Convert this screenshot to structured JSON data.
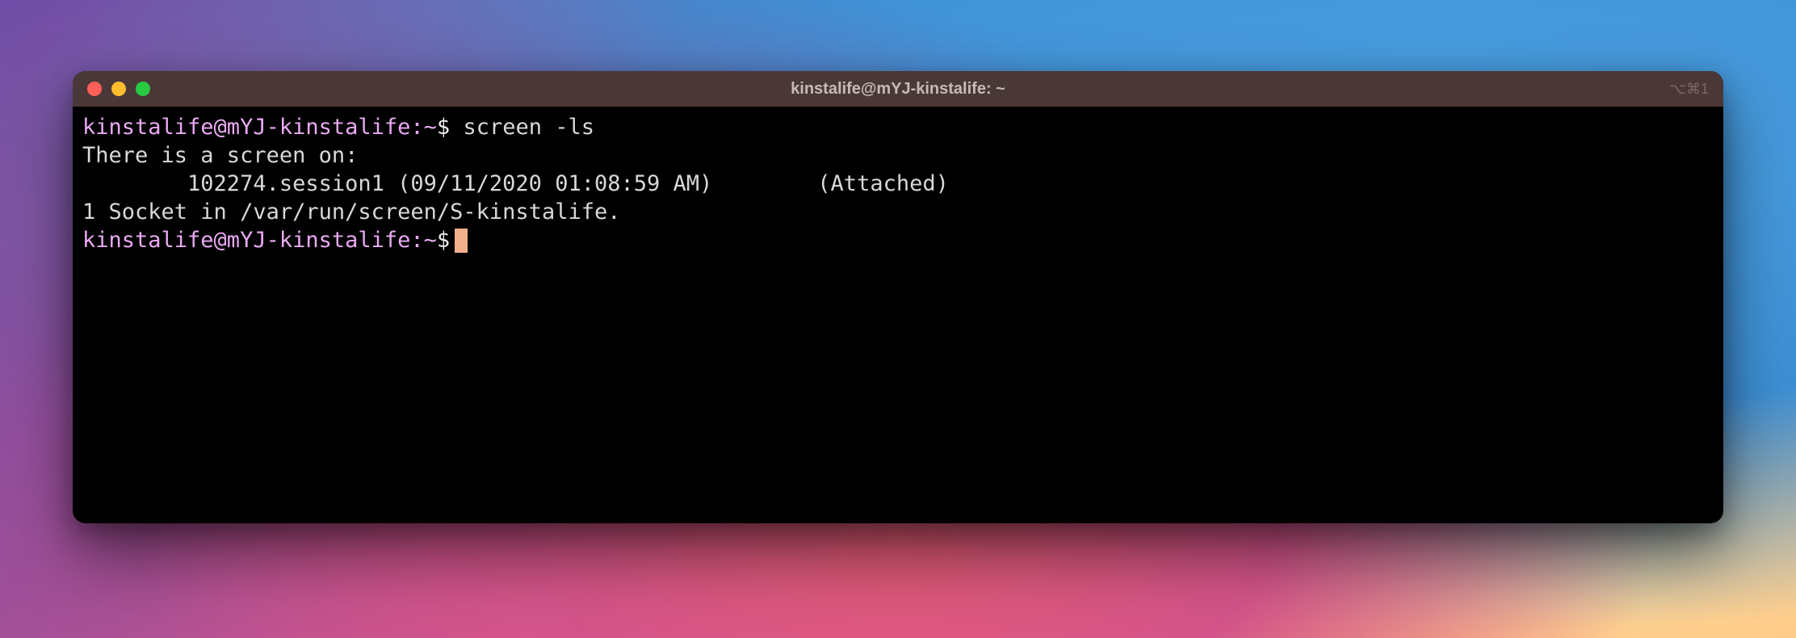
{
  "window": {
    "title": "kinstalife@mYJ-kinstalife: ~",
    "shortcut": "⌥⌘1"
  },
  "terminal": {
    "prompt_user_host": "kinstalife@mYJ-kinstalife",
    "prompt_path": "~",
    "prompt_dollar": "$",
    "lines": [
      {
        "type": "command",
        "command": "screen -ls"
      },
      {
        "type": "output",
        "text": "There is a screen on:"
      },
      {
        "type": "output",
        "text": "        102274.session1 (09/11/2020 01:08:59 AM)        (Attached)"
      },
      {
        "type": "output",
        "text": "1 Socket in /var/run/screen/S-kinstalife."
      },
      {
        "type": "prompt"
      }
    ]
  }
}
